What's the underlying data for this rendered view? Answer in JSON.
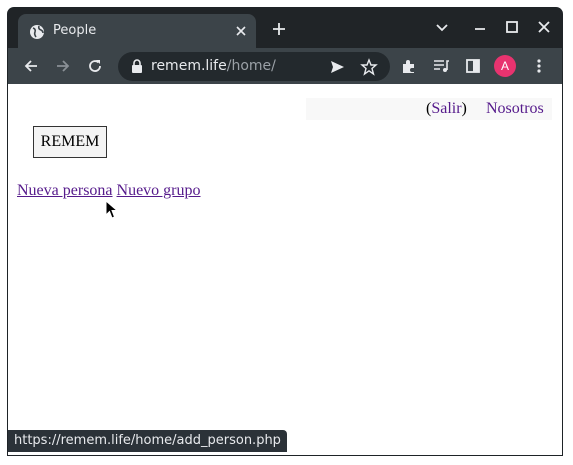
{
  "browser": {
    "tab_title": "People",
    "url_host": "remem.life",
    "url_path": "/home/",
    "profile_initial": "A",
    "status_url": "https://remem.life/home/add_person.php"
  },
  "page": {
    "nav": {
      "open_paren": "(",
      "logout": "Salir",
      "close_paren": ")",
      "about": "Nosotros"
    },
    "brand_button": "REMEM",
    "actions": {
      "new_person": "Nueva persona",
      "new_group": "Nuevo grupo"
    }
  },
  "colors": {
    "link_visited": "#551a8b",
    "avatar": "#e8336f",
    "chrome_dark": "#202427"
  },
  "icons": [
    "globe-icon",
    "close-icon",
    "plus-icon",
    "chevron-down-icon",
    "minimize-icon",
    "maximize-icon",
    "window-close-icon",
    "back-arrow-icon",
    "forward-arrow-icon",
    "reload-icon",
    "lock-icon",
    "send-icon",
    "star-icon",
    "extensions-icon",
    "media-icon",
    "sidepanel-icon",
    "menu-kebab-icon",
    "cursor-icon"
  ]
}
